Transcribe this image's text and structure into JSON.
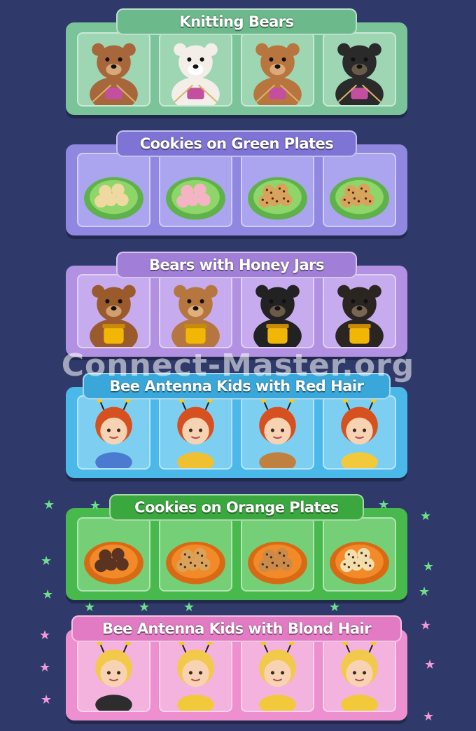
{
  "watermark": "Connect-Master.org",
  "groups": [
    {
      "title": "Knitting Bears",
      "panel_color": "#7bc49a",
      "pill_color": "#6cb98b",
      "tile_color": "#9ed6b3",
      "items": [
        {
          "icon": "brown-bear-knitting-icon"
        },
        {
          "icon": "white-bear-knitting-icon"
        },
        {
          "icon": "brown-bear-hat-knitting-icon"
        },
        {
          "icon": "black-bear-knitting-icon"
        }
      ]
    },
    {
      "title": "Cookies on Green Plates",
      "panel_color": "#8f87e0",
      "pill_color": "#7d74d6",
      "tile_color": "#aba4ee",
      "items": [
        {
          "icon": "shortbread-cookies-plate-icon"
        },
        {
          "icon": "cookie-tower-plate-icon"
        },
        {
          "icon": "choc-chip-cookies-plate-icon"
        },
        {
          "icon": "choc-chip-cookies-round-plate-icon"
        }
      ]
    },
    {
      "title": "Bears with Honey Jars",
      "panel_color": "#b291e3",
      "pill_color": "#a17fd8",
      "tile_color": "#c6acef",
      "items": [
        {
          "icon": "brown-bear-honey-jar-icon"
        },
        {
          "icon": "brown-cub-honey-jar-icon"
        },
        {
          "icon": "black-bear-honey-jar-icon"
        },
        {
          "icon": "black-cub-honey-jar-icon"
        }
      ]
    },
    {
      "title": "Bee Antenna Kids with Red Hair",
      "panel_color": "#4ab8e8",
      "pill_color": "#39a7d9",
      "tile_color": "#7dcff2",
      "items": [
        {
          "icon": "red-hair-boy-antenna-icon"
        },
        {
          "icon": "red-hair-girl-antenna-icon"
        },
        {
          "icon": "red-curly-hair-kid-bear-icon"
        },
        {
          "icon": "red-bun-hair-kid-antenna-icon"
        }
      ]
    },
    {
      "title": "Cookies on Orange Plates",
      "panel_color": "#48b94c",
      "pill_color": "#3aa83f",
      "tile_color": "#74cf77",
      "items": [
        {
          "icon": "swirl-cookies-orange-plate-icon"
        },
        {
          "icon": "cookie-stack-orange-plate-icon"
        },
        {
          "icon": "cookies-pile-orange-plate-icon"
        },
        {
          "icon": "single-cookie-orange-plate-icon"
        }
      ]
    },
    {
      "title": "Bee Antenna Kids with Blond Hair",
      "panel_color": "#ee8fd0",
      "pill_color": "#e27bc3",
      "tile_color": "#f4b3df",
      "items": [
        {
          "icon": "blond-braids-girl-antenna-icon"
        },
        {
          "icon": "blond-buns-kid-antenna-icon"
        },
        {
          "icon": "blond-boy-antenna-icon"
        },
        {
          "icon": "blond-curly-girl-antenna-icon"
        }
      ]
    }
  ]
}
